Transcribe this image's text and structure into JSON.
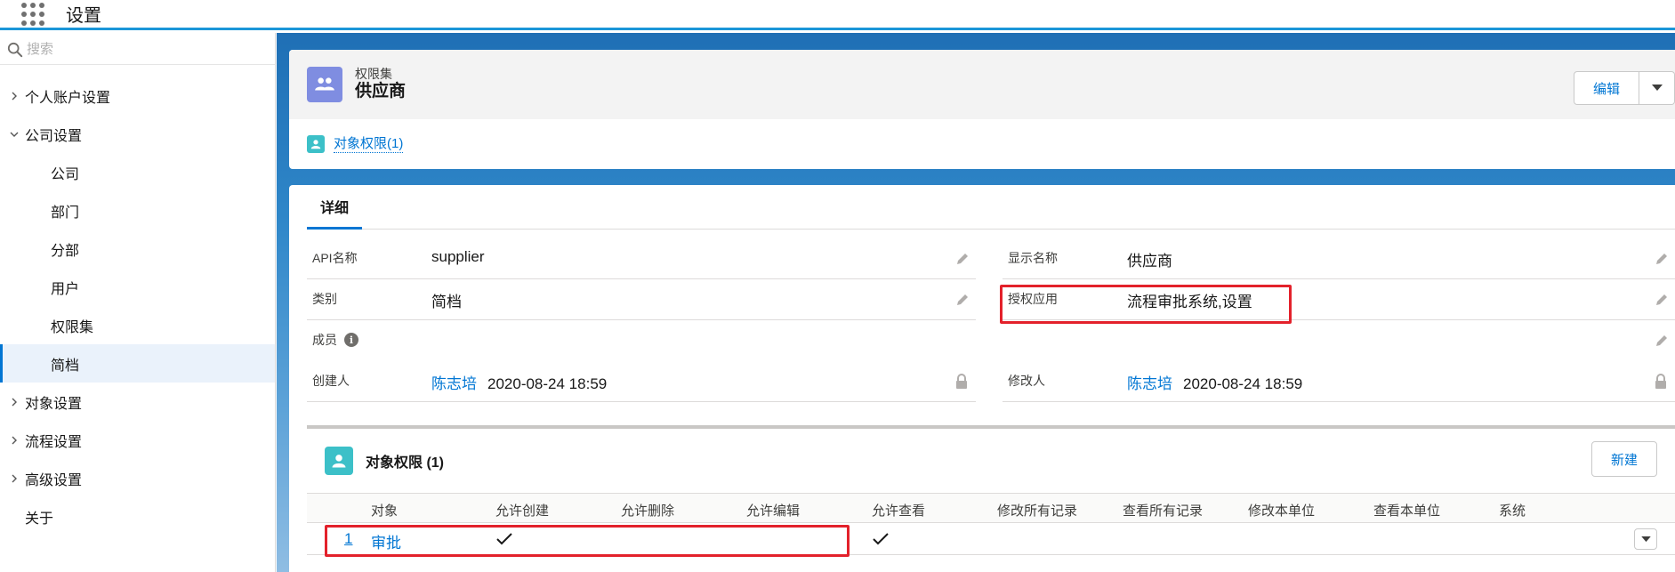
{
  "app": {
    "title": "设置"
  },
  "sidebar": {
    "search_placeholder": "搜索",
    "items": [
      {
        "label": "个人账户设置",
        "level": "top",
        "expanded": false
      },
      {
        "label": "公司设置",
        "level": "top",
        "expanded": true
      },
      {
        "label": "公司",
        "level": "sub"
      },
      {
        "label": "部门",
        "level": "sub"
      },
      {
        "label": "分部",
        "level": "sub"
      },
      {
        "label": "用户",
        "level": "sub"
      },
      {
        "label": "权限集",
        "level": "sub"
      },
      {
        "label": "简档",
        "level": "sub",
        "active": true
      },
      {
        "label": "对象设置",
        "level": "top",
        "expanded": false
      },
      {
        "label": "流程设置",
        "level": "top",
        "expanded": false
      },
      {
        "label": "高级设置",
        "level": "top",
        "expanded": false
      },
      {
        "label": "关于",
        "level": "top",
        "leaf": true
      }
    ]
  },
  "record": {
    "object_label": "权限集",
    "name": "供应商",
    "edit_label": "编辑",
    "related_link": "对象权限(1)"
  },
  "tabs": {
    "details": "详细"
  },
  "fields": {
    "api_name_label": "API名称",
    "api_name_value": "supplier",
    "display_name_label": "显示名称",
    "display_name_value": "供应商",
    "category_label": "类别",
    "category_value": "简档",
    "authorized_apps_label": "授权应用",
    "authorized_apps_value": "流程审批系统,设置",
    "members_label": "成员",
    "created_by_label": "创建人",
    "created_by_user": "陈志培",
    "created_date": "2020-08-24 18:59",
    "modified_by_label": "修改人",
    "modified_by_user": "陈志培",
    "modified_date": "2020-08-24 18:59"
  },
  "related_list": {
    "title": "对象权限 (1)",
    "new_label": "新建",
    "columns": [
      "对象",
      "允许创建",
      "允许删除",
      "允许编辑",
      "允许查看",
      "修改所有记录",
      "查看所有记录",
      "修改本单位",
      "查看本单位",
      "系统"
    ],
    "rows": [
      {
        "num": "1",
        "object": "审批",
        "allow_create": true,
        "allow_delete": false,
        "allow_edit": false,
        "allow_view": true
      }
    ]
  },
  "colors": {
    "brand_blue": "#0176d3",
    "header_stripe": "#1b96d8",
    "highlight_red": "#e3212b",
    "permset_icon": "#7f8de1",
    "objperm_icon": "#3cc0c8"
  },
  "icons": {
    "app_launcher": "app-launcher-icon",
    "search": "search-icon",
    "permission_set": "permission-set-icon",
    "object_permission": "object-permission-icon",
    "edit": "pencil-icon",
    "lock": "lock-icon",
    "info": "info-icon",
    "checkmark": "checkmark-icon",
    "dropdown": "chevron-down-icon"
  }
}
